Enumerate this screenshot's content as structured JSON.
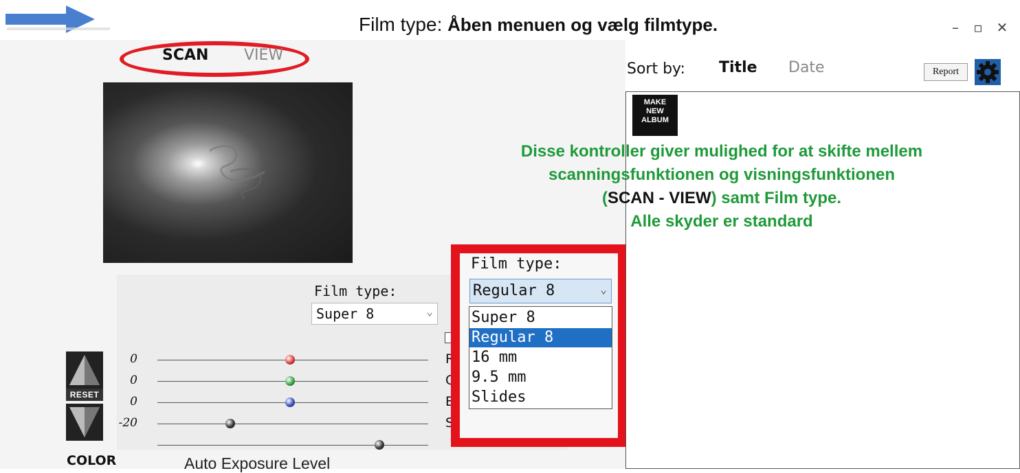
{
  "header": {
    "title_prefix": "Film type:",
    "title_hint": "Åben menuen og vælg filmtype.",
    "arrow_icon": "arrow-right-icon",
    "window_controls": {
      "minimize": "–",
      "maximize": "▫",
      "close": "✕"
    }
  },
  "mode_tabs": {
    "scan": "SCAN",
    "view": "VIEW"
  },
  "film_type_small": {
    "label": "Film type:",
    "value": "Super 8"
  },
  "sliders": [
    {
      "value": "0",
      "label": "R",
      "color": "#e53b3b",
      "level": 0.49
    },
    {
      "value": "0",
      "label": "G",
      "color": "#3aa845",
      "level": 0.49
    },
    {
      "value": "0",
      "label": "B",
      "color": "#3b4fc4",
      "level": 0.49
    },
    {
      "value": "-20",
      "label": "S",
      "color": "#333333",
      "level": 0.27
    },
    {
      "value": "",
      "label": "",
      "color": "#333333",
      "level": 0.82
    }
  ],
  "buttons": {
    "reset": "RESET",
    "color": "COLOR",
    "auto_exposure": "Auto Exposure Level"
  },
  "film_type_dropdown": {
    "label": "Film type:",
    "selected": "Regular 8",
    "options": [
      "Super 8",
      "Regular 8",
      "16 mm",
      "9.5 mm",
      "Slides"
    ],
    "highlighted_index": 1
  },
  "sort": {
    "label": "Sort by:",
    "title": "Title",
    "date": "Date"
  },
  "report_label": "Report",
  "make_album": {
    "line1": "MAKE",
    "line2": "NEW",
    "line3": "ALBUM"
  },
  "annotation": {
    "line1": "Disse kontroller giver mulighed for at skifte mellem",
    "line2": "scanningsfunktionen  og visningsfunktionen",
    "line3_open": "(",
    "line3_scanview": "SCAN - VIEW",
    "line3_rest": ") samt Film type.",
    "line4": "Alle skyder er standard"
  },
  "colors": {
    "annotation_green": "#1f9a3a",
    "highlight_red": "#e4121b",
    "selection_blue": "#1f6fc4"
  }
}
